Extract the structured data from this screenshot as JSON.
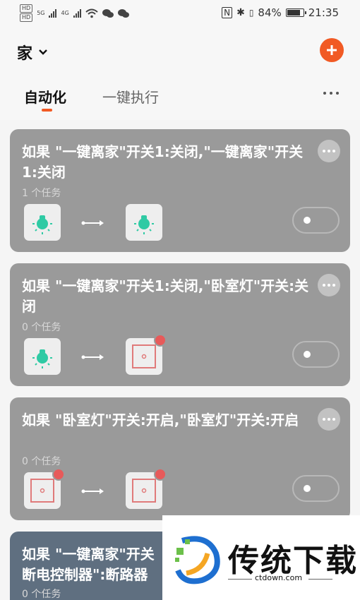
{
  "status_bar": {
    "left_badge_1": "HD",
    "left_badge_2": "HD",
    "net_1": "5G",
    "net_2": "4G",
    "battery_text": "84%",
    "battery_level": 0.84,
    "time": "21:35"
  },
  "header": {
    "home_title": "家",
    "tabs": [
      {
        "label": "自动化"
      },
      {
        "label": "一键执行"
      }
    ]
  },
  "cards": [
    {
      "title": "如果 \"一键离家\"开关1:关闭,\"一键离家\"开关1:关闭",
      "subtitle": "1 个任务",
      "from_icon": "lamp-icon",
      "to_icon": "lamp-icon"
    },
    {
      "title": "如果 \"一键离家\"开关1:关闭,\"卧室灯\"开关:关闭",
      "subtitle": "0 个任务",
      "from_icon": "lamp-icon",
      "to_icon": "socket-icon"
    },
    {
      "title": "如果 \"卧室灯\"开关:开启,\"卧室灯\"开关:开启",
      "subtitle": "0 个任务",
      "from_icon": "socket-icon",
      "to_icon": "socket-icon"
    },
    {
      "title": "如果 \"一键离家\"开关 断电控制器\":断路器",
      "subtitle": "0 个任务"
    }
  ],
  "watermark": {
    "brand": "传统下载",
    "url": "ctdown.com"
  },
  "colors": {
    "accent": "#f15a24",
    "card": "#9a9a9a",
    "teal": "#2fcaa4",
    "badge": "#e75a5a"
  }
}
